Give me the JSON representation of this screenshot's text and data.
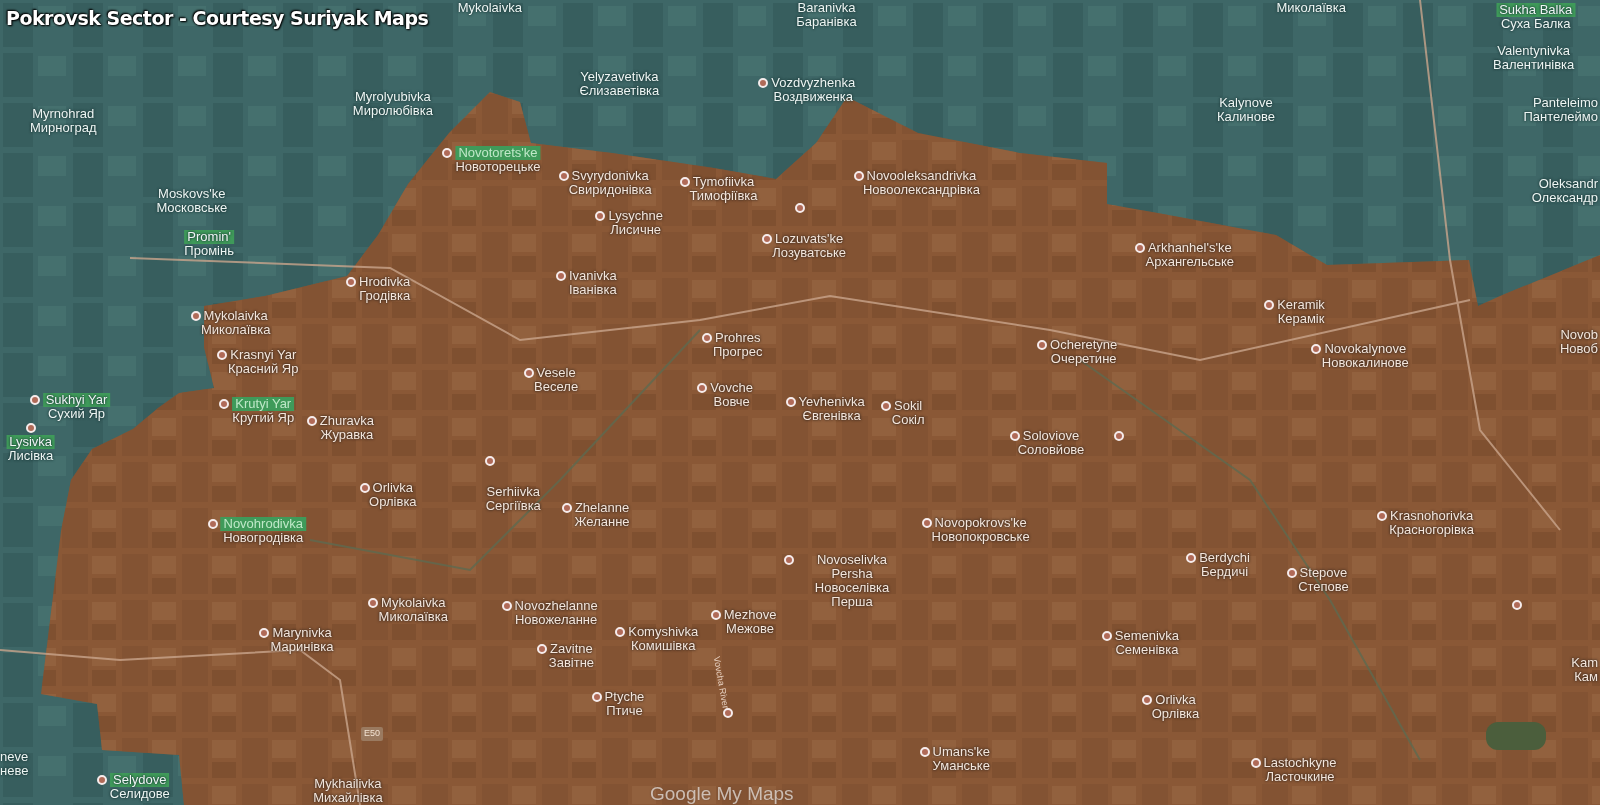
{
  "title": "Pokrovsk Sector - Courtesy Suriyak Maps",
  "places": [
    {
      "name": "Mykolaivka",
      "highlighted": false,
      "pin": false
    },
    {
      "name": "Baranivka",
      "name_uk": "Баранівка",
      "highlighted": false,
      "pin": false
    },
    {
      "name_uk": "Миколаївка",
      "highlighted": false,
      "pin": false
    },
    {
      "name": "Sukha Balka",
      "name_uk": "Суха Балка",
      "highlighted": true,
      "pin": false
    },
    {
      "name": "Valentynivka",
      "name_uk": "Валентинівка",
      "highlighted": false,
      "pin": false
    },
    {
      "name": "Myrnohrad",
      "name_uk": "Мирноград",
      "highlighted": false,
      "pin": false
    },
    {
      "name": "Myrolyubivka",
      "name_uk": "Миролюбівка",
      "highlighted": false,
      "pin": false
    },
    {
      "name": "Yelyzavetivka",
      "name_uk": "Єлизаветівка",
      "highlighted": false,
      "pin": false
    },
    {
      "name": "Vozdvyzhenka",
      "name_uk": "Воздвиженка",
      "highlighted": false,
      "pin": true
    },
    {
      "name": "Kalynove",
      "name_uk": "Калинове",
      "highlighted": false,
      "pin": false
    },
    {
      "name": "Panteleimo",
      "name_uk": "Пантелеймо",
      "highlighted": false,
      "pin": false
    },
    {
      "name": "Novotorets'ke",
      "name_uk": "Новоторецьке",
      "highlighted": true,
      "pin": true
    },
    {
      "name": "Svyrydonivka",
      "name_uk": "Свиридонівка",
      "highlighted": false,
      "pin": true
    },
    {
      "name": "Tymofiivka",
      "name_uk": "Тимофіївка",
      "highlighted": false,
      "pin": true
    },
    {
      "name": "Novooleksandrivka",
      "name_uk": "Новоолександрівка",
      "highlighted": false,
      "pin": true
    },
    {
      "name": "Oleksandr",
      "name_uk": "Олександр",
      "highlighted": false,
      "pin": false
    },
    {
      "name": "Moskovs'ke",
      "name_uk": "Московське",
      "highlighted": false,
      "pin": false
    },
    {
      "name": "Lysychne",
      "name_uk": "Лисичне",
      "highlighted": false,
      "pin": true
    },
    {
      "name": "Promin'",
      "name_uk": "Промінь",
      "highlighted": true,
      "pin": false
    },
    {
      "name": "Lozuvats'ke",
      "name_uk": "Лозуватське",
      "highlighted": false,
      "pin": true
    },
    {
      "name": "Arkhanhel's'ke",
      "name_uk": "Архангельське",
      "highlighted": false,
      "pin": true
    },
    {
      "name": "Hrodivka",
      "name_uk": "Гродівка",
      "highlighted": false,
      "pin": true
    },
    {
      "name": "Ivanivka",
      "name_uk": "Іванівка",
      "highlighted": false,
      "pin": true
    },
    {
      "name": "Mykolaivka",
      "name_uk": "Миколаївка",
      "highlighted": false,
      "pin": true
    },
    {
      "name": "Keramik",
      "name_uk": "Керамік",
      "highlighted": false,
      "pin": true
    },
    {
      "name": "Krasnyi Yar",
      "name_uk": "Красний Яр",
      "highlighted": false,
      "pin": true
    },
    {
      "name": "Prohres",
      "name_uk": "Прогрес",
      "highlighted": false,
      "pin": true
    },
    {
      "name": "Ocheretyne",
      "name_uk": "Очеретине",
      "highlighted": false,
      "pin": true
    },
    {
      "name": "Novokalynove",
      "name_uk": "Новокалинове",
      "highlighted": false,
      "pin": true
    },
    {
      "name": "Novob",
      "name_uk": "Новоб",
      "highlighted": false,
      "pin": false
    },
    {
      "name": "Sukhyi Yar",
      "name_uk": "Сухий Яр",
      "highlighted": true,
      "pin": true
    },
    {
      "name": "Krutyi Yar",
      "name_uk": "Крутий Яр",
      "highlighted": true,
      "pin": true
    },
    {
      "name": "Vesele",
      "name_uk": "Веселе",
      "highlighted": false,
      "pin": true
    },
    {
      "name": "Vovche",
      "name_uk": "Вовче",
      "highlighted": false,
      "pin": true
    },
    {
      "name": "Yevhenivka",
      "name_uk": "Євгенівка",
      "highlighted": false,
      "pin": true
    },
    {
      "name": "Sokil",
      "name_uk": "Сокіл",
      "highlighted": false,
      "pin": true
    },
    {
      "name": "Lysivka",
      "name_uk": "Лисівка",
      "highlighted": true,
      "pin": true
    },
    {
      "name": "Zhuravka",
      "name_uk": "Журавка",
      "highlighted": false,
      "pin": true
    },
    {
      "name": "Soloviove",
      "name_uk": "Соловйове",
      "highlighted": false,
      "pin": true
    },
    {
      "name": "Orlivka",
      "name_uk": "Орлівка",
      "highlighted": false,
      "pin": true
    },
    {
      "name": "Serhiivka",
      "name_uk": "Сергіївка",
      "highlighted": false,
      "pin": false
    },
    {
      "name": "Novohrodivka",
      "name_uk": "Новогродівка",
      "highlighted": true,
      "pin": true
    },
    {
      "name": "Zhelanne",
      "name_uk": "Желанне",
      "highlighted": false,
      "pin": true
    },
    {
      "name": "Novopokrovs'ke",
      "name_uk": "Новопокровське",
      "highlighted": false,
      "pin": true
    },
    {
      "name": "Krasnohorivka",
      "name_uk": "Красногорівка",
      "highlighted": false,
      "pin": true
    },
    {
      "name": "Novoselivka Persha",
      "name_uk": "Новоселівка Перша",
      "highlighted": false,
      "pin": true
    },
    {
      "name": "Berdychi",
      "name_uk": "Бердичі",
      "highlighted": false,
      "pin": true
    },
    {
      "name": "Stepove",
      "name_uk": "Степове",
      "highlighted": false,
      "pin": true
    },
    {
      "name": "Mykolaivka",
      "name_uk": "Миколаївка",
      "highlighted": false,
      "pin": true
    },
    {
      "name": "Novozhelanne",
      "name_uk": "Новожеланне",
      "highlighted": false,
      "pin": true
    },
    {
      "name": "Mezhove",
      "name_uk": "Межове",
      "highlighted": false,
      "pin": true
    },
    {
      "name": "Marynivka",
      "name_uk": "Маринівка",
      "highlighted": false,
      "pin": true
    },
    {
      "name": "Komyshivka",
      "name_uk": "Комишівка",
      "highlighted": false,
      "pin": true
    },
    {
      "name": "Semenivka",
      "name_uk": "Семенівка",
      "highlighted": false,
      "pin": true
    },
    {
      "name": "Zavitne",
      "name_uk": "Завітне",
      "highlighted": false,
      "pin": true
    },
    {
      "name": "Kam",
      "name_uk": "Кам",
      "highlighted": false,
      "pin": false
    },
    {
      "name": "Ptyche",
      "name_uk": "Птиче",
      "highlighted": false,
      "pin": true
    },
    {
      "name": "Orlivka",
      "name_uk": "Орлівка",
      "highlighted": false,
      "pin": true
    },
    {
      "name": "neve",
      "name_uk": "неве",
      "highlighted": false,
      "pin": false
    },
    {
      "name": "Umans'ke",
      "name_uk": "Уманське",
      "highlighted": false,
      "pin": true
    },
    {
      "name": "Lastochkyne",
      "name_uk": "Ласточкине",
      "highlighted": false,
      "pin": true
    },
    {
      "name": "Selydove",
      "name_uk": "Селидове",
      "highlighted": true,
      "pin": true
    },
    {
      "name": "Mykhailivka",
      "name_uk": "Михайлівка",
      "highlighted": false,
      "pin": false
    }
  ],
  "road_label": "E50",
  "river_label": "Vovcha River",
  "provider_logo": "Google My Maps"
}
